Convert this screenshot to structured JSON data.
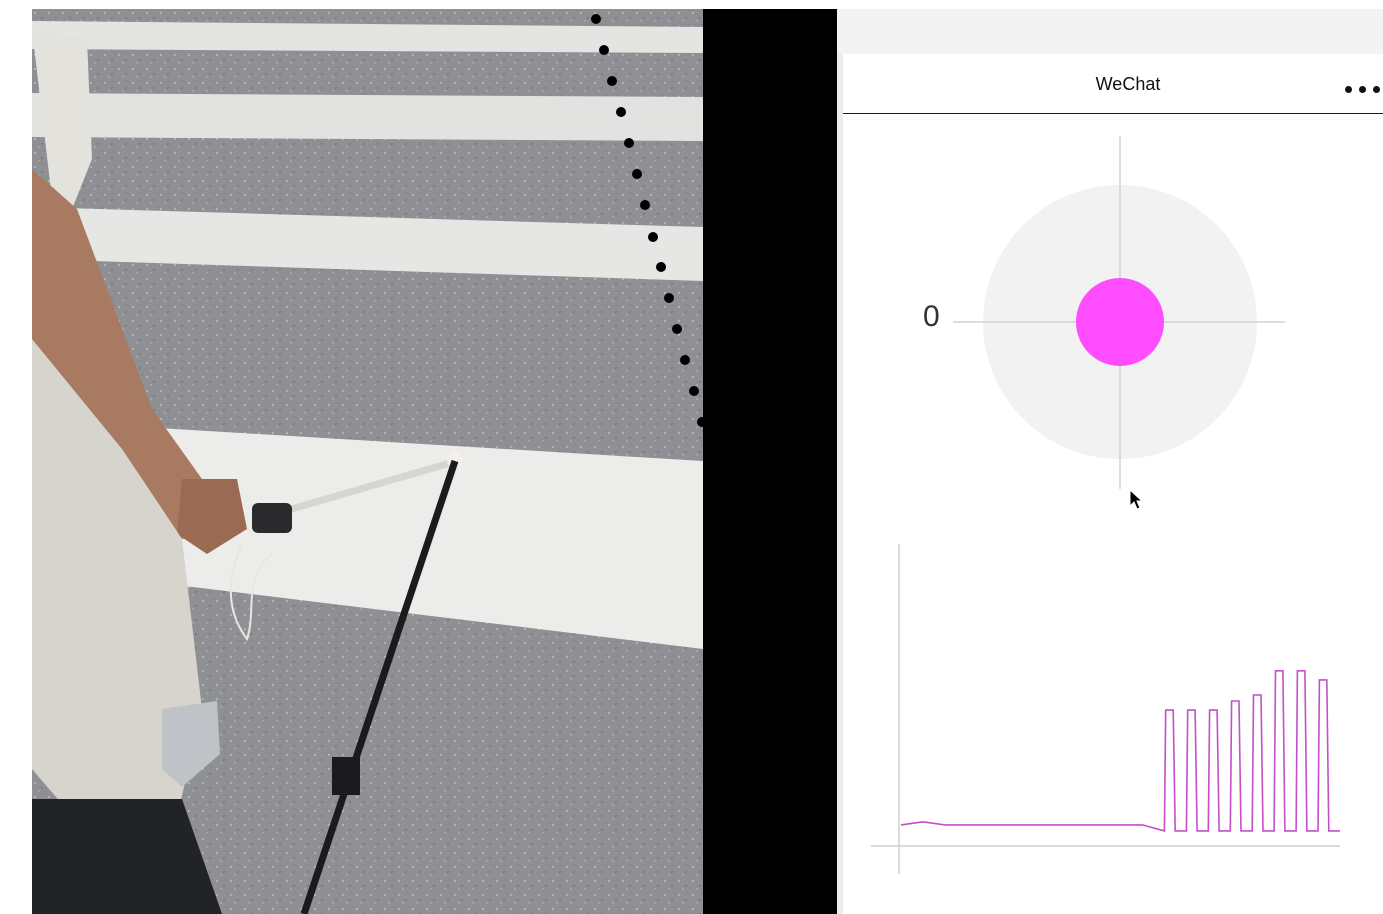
{
  "video": {
    "description_icon": "video-frame"
  },
  "phone": {
    "nav": {
      "title": "WeChat",
      "more_icon": "more-dots-icon"
    },
    "joystick": {
      "axis_label": "0",
      "dot_color": "#ff4cff",
      "ring_color": "#f2f2f2"
    },
    "signal_chart": {
      "line_color": "#c34fc9"
    }
  },
  "chart_data": {
    "type": "line",
    "title": "",
    "xlabel": "",
    "ylabel": "",
    "x": [
      0,
      5,
      10,
      15,
      20,
      25,
      30,
      35,
      40,
      45,
      50,
      55,
      60,
      62,
      65,
      67,
      70,
      72,
      75,
      77,
      80,
      82,
      85,
      87,
      90,
      92,
      95,
      97,
      100
    ],
    "series": [
      {
        "values": [
          0.07,
          0.08,
          0.07,
          0.07,
          0.07,
          0.07,
          0.07,
          0.07,
          0.07,
          0.07,
          0.07,
          0.07,
          0.05,
          0.45,
          0.05,
          0.45,
          0.05,
          0.45,
          0.05,
          0.48,
          0.05,
          0.5,
          0.05,
          0.58,
          0.05,
          0.58,
          0.05,
          0.55,
          0.05
        ]
      }
    ],
    "grid": false
  }
}
